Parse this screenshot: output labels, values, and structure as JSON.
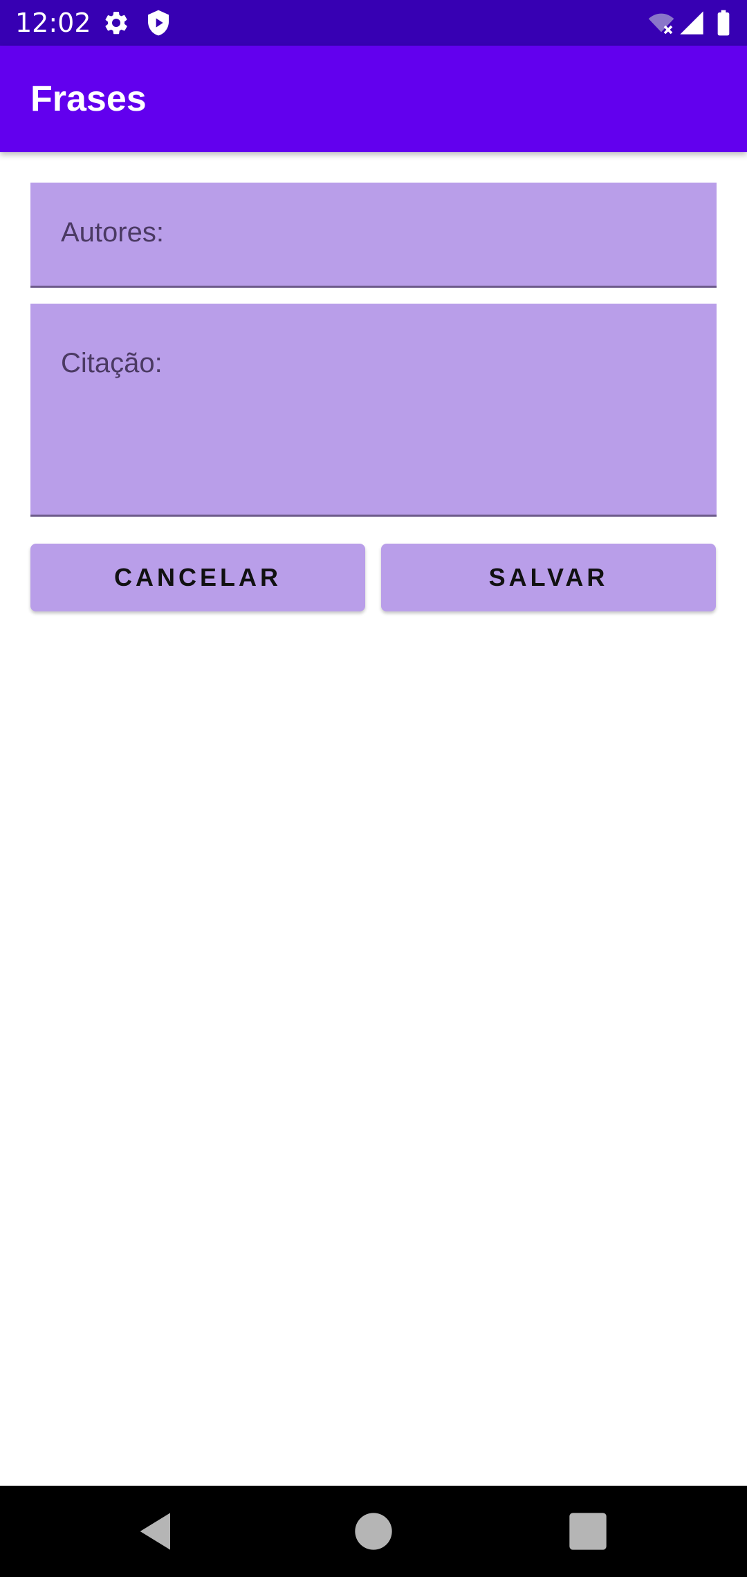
{
  "status_bar": {
    "time": "12:02",
    "icons": [
      "settings-icon",
      "shield-play-icon",
      "wifi-off-icon",
      "signal-icon",
      "battery-icon"
    ]
  },
  "app_bar": {
    "title": "Frases"
  },
  "form": {
    "authors_placeholder": "Autores:",
    "quote_placeholder": "Citação:",
    "cancel_label": "CANCELAR",
    "save_label": "SALVAR"
  },
  "nav_bar": {
    "icons": [
      "back-icon",
      "home-icon",
      "recents-icon"
    ]
  },
  "colors": {
    "status_bar": "#3700b3",
    "app_bar": "#6200ee",
    "field_fill": "#b99ee9",
    "button_fill": "#b99ee9"
  }
}
